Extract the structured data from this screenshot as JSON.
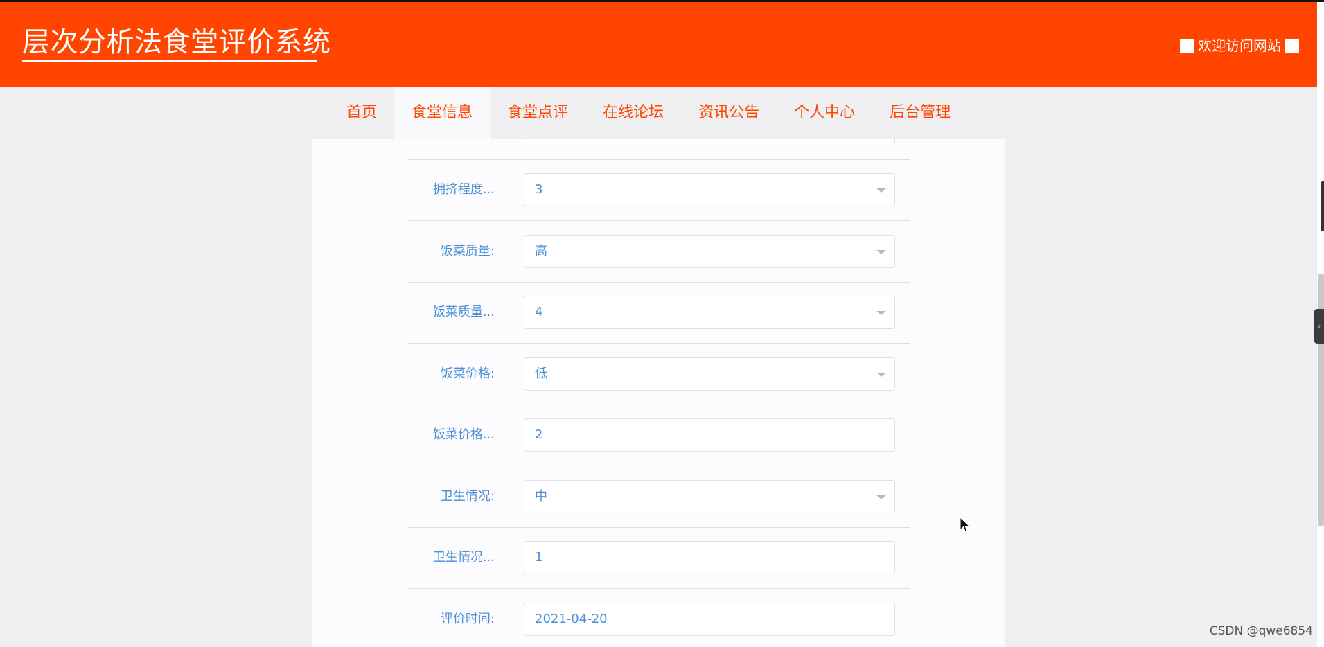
{
  "header": {
    "title": "层次分析法食堂评价系统",
    "welcome": "欢迎访问网站"
  },
  "colors": {
    "brand": "#ff4500",
    "label": "#4a8fd4",
    "border": "#dcdfe6"
  },
  "nav": {
    "active": "食堂信息",
    "items": [
      {
        "label": "首页"
      },
      {
        "label": "食堂信息"
      },
      {
        "label": "食堂点评"
      },
      {
        "label": "在线论坛"
      },
      {
        "label": "资讯公告"
      },
      {
        "label": "个人中心"
      },
      {
        "label": "后台管理"
      }
    ]
  },
  "form": {
    "rows": [
      {
        "label": "",
        "value": "",
        "type": "select"
      },
      {
        "label": "拥挤程度...",
        "value": "3",
        "type": "select"
      },
      {
        "label": "饭菜质量:",
        "value": "高",
        "type": "select"
      },
      {
        "label": "饭菜质量...",
        "value": "4",
        "type": "select"
      },
      {
        "label": "饭菜价格:",
        "value": "低",
        "type": "select"
      },
      {
        "label": "饭菜价格...",
        "value": "2",
        "type": "input"
      },
      {
        "label": "卫生情况:",
        "value": "中",
        "type": "select"
      },
      {
        "label": "卫生情况...",
        "value": "1",
        "type": "input"
      },
      {
        "label": "评价时间:",
        "value": "2021-04-20",
        "type": "input"
      }
    ]
  },
  "icons": {
    "dropdown": "caret-down-icon",
    "cursor": "mouse-pointer-icon",
    "side_handle": "chevron-left-icon"
  },
  "side_handle_glyph": "‹",
  "watermark": "CSDN @qwe6854"
}
